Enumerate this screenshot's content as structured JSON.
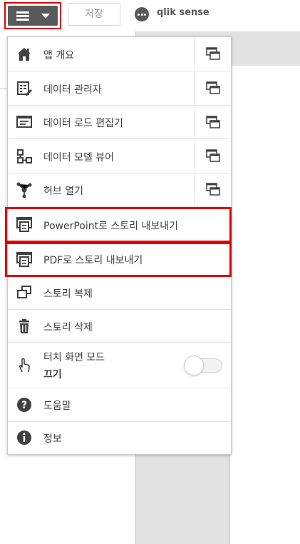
{
  "toolbar": {
    "save_label": "저장",
    "app_name": "qlik sense"
  },
  "menu": {
    "items": [
      {
        "label": "앱 개요",
        "icon": "home-icon",
        "new_tab": true
      },
      {
        "label": "데이터 관리자",
        "icon": "data-manager-icon",
        "new_tab": true
      },
      {
        "label": "데이터 로드 편집기",
        "icon": "load-editor-icon",
        "new_tab": true
      },
      {
        "label": "데이터 모델 뷰어",
        "icon": "model-viewer-icon",
        "new_tab": true
      },
      {
        "label": "허브 열기",
        "icon": "hub-icon",
        "new_tab": true
      },
      {
        "label": "PowerPoint로 스토리 내보내기",
        "icon": "export-icon"
      },
      {
        "label": "PDF로 스토리 내보내기",
        "icon": "export-icon"
      },
      {
        "label": "스토리 복제",
        "icon": "duplicate-icon"
      },
      {
        "label": "스토리 삭제",
        "icon": "trash-icon"
      },
      {
        "label": "터치 화면 모드",
        "sub": "끄기",
        "icon": "touch-icon",
        "toggle_on": false
      },
      {
        "label": "도움말",
        "icon": "help-icon"
      },
      {
        "label": "정보",
        "icon": "info-icon"
      }
    ]
  },
  "colors": {
    "highlight": "#e00000",
    "button_dark": "#595959"
  }
}
